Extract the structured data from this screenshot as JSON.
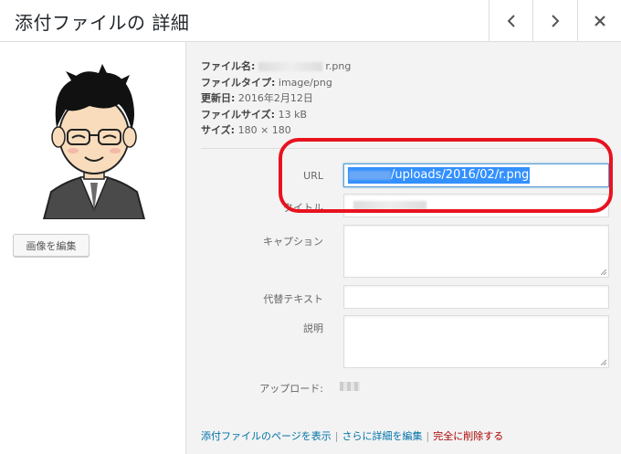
{
  "header": {
    "title": "添付ファイルの 詳細",
    "prev_icon": "chevron-left-icon",
    "next_icon": "chevron-right-icon",
    "close_icon": "close-icon"
  },
  "left": {
    "edit_image_label": "画像を編集"
  },
  "details": {
    "file_name_label": "ファイル名:",
    "file_name_value": "r.png",
    "file_type_label": "ファイルタイプ:",
    "file_type_value": "image/png",
    "uploaded_on_label": "更新日:",
    "uploaded_on_value": "2016年2月12日",
    "file_size_label": "ファイルサイズ:",
    "file_size_value": "13 kB",
    "dimensions_label": "サイズ:",
    "dimensions_value": "180 × 180"
  },
  "form": {
    "url_label": "URL",
    "url_value": "/uploads/2016/02/r.png",
    "title_label": "タイトル",
    "caption_label": "キャプション",
    "alt_label": "代替テキスト",
    "description_label": "説明",
    "uploaded_by_label": "アップロード:"
  },
  "actions": {
    "view_page": "添付ファイルのページを表示",
    "edit_more": "さらに詳細を編集",
    "delete": "完全に削除する",
    "pipe": "|"
  },
  "colors": {
    "highlight_border": "#e8121f",
    "link": "#0073aa",
    "delete_link": "#aa0000",
    "selection": "#3390ff"
  }
}
